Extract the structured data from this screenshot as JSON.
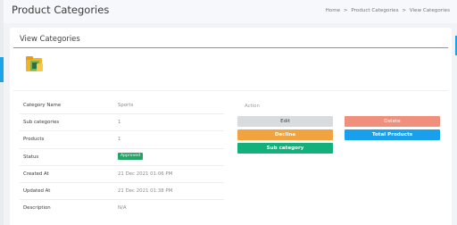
{
  "header": {
    "title": "Product Categories",
    "breadcrumb": [
      "Home",
      "Product Categories",
      "View Categories"
    ],
    "separator": ">"
  },
  "card": {
    "title": "View Categories"
  },
  "details": [
    {
      "label": "Category Name",
      "value": "Sports"
    },
    {
      "label": "Sub categories",
      "value": "1"
    },
    {
      "label": "Products",
      "value": "1"
    },
    {
      "label": "Status",
      "value": "Approved"
    },
    {
      "label": "Created At",
      "value": "21 Dec 2021 01:06 PM"
    },
    {
      "label": "Updated At",
      "value": "21 Dec 2021 01:38 PM"
    },
    {
      "label": "Description",
      "value": "N/A"
    }
  ],
  "actions": {
    "label": "Action",
    "edit": "Edit",
    "delete": "Delete",
    "decline": "Decline",
    "total_products": "Total Products",
    "sub_category": "Sub category"
  },
  "colors": {
    "accent": "#1aa3e8",
    "approved": "#23a566",
    "delete": "#f08f7b",
    "decline": "#f0a33f",
    "total": "#18a0ec",
    "sub": "#13b07c"
  }
}
